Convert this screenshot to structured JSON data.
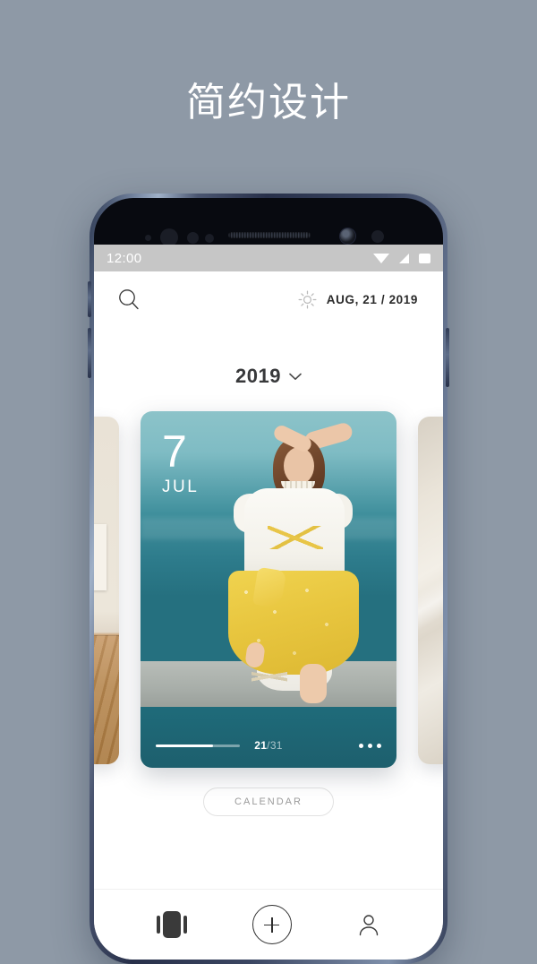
{
  "promo": {
    "headline": "简约设计"
  },
  "colors": {
    "background": "#8e99a6",
    "card_teal": "#3f8f9c",
    "accent_yellow": "#e8c63f",
    "text_dark": "#2b2b2b",
    "status_bar": "#c6c6c6"
  },
  "phone": {
    "status_bar": {
      "time": "12:00",
      "icons": [
        "wifi-icon",
        "signal-icon",
        "battery-icon"
      ]
    },
    "app_bar": {
      "search_icon": "search-icon",
      "brightness_icon": "sun-icon",
      "date": "AUG, 21 / 2019"
    },
    "year_selector": {
      "label": "2019",
      "chevron": "chevron-down-icon"
    },
    "carousel": {
      "cards": [
        {
          "position": "left-peek",
          "photo": "interior-room-photo"
        },
        {
          "position": "center",
          "day": "7",
          "month": "JUL",
          "photo": "woman-by-the-sea-photo",
          "page_current": "21",
          "page_separator": "/",
          "page_total": "31",
          "progress_percent": 68,
          "more_icon": "more-dots-icon"
        },
        {
          "position": "right-peek",
          "photo": "soft-fabric-photo"
        }
      ]
    },
    "calendar_button": {
      "label": "CALENDAR"
    },
    "bottom_nav": {
      "items": [
        {
          "name": "cards",
          "icon": "carousel-cards-icon",
          "active": true
        },
        {
          "name": "add",
          "icon": "plus-circle-icon",
          "active": false
        },
        {
          "name": "profile",
          "icon": "person-icon",
          "active": false
        }
      ]
    }
  }
}
